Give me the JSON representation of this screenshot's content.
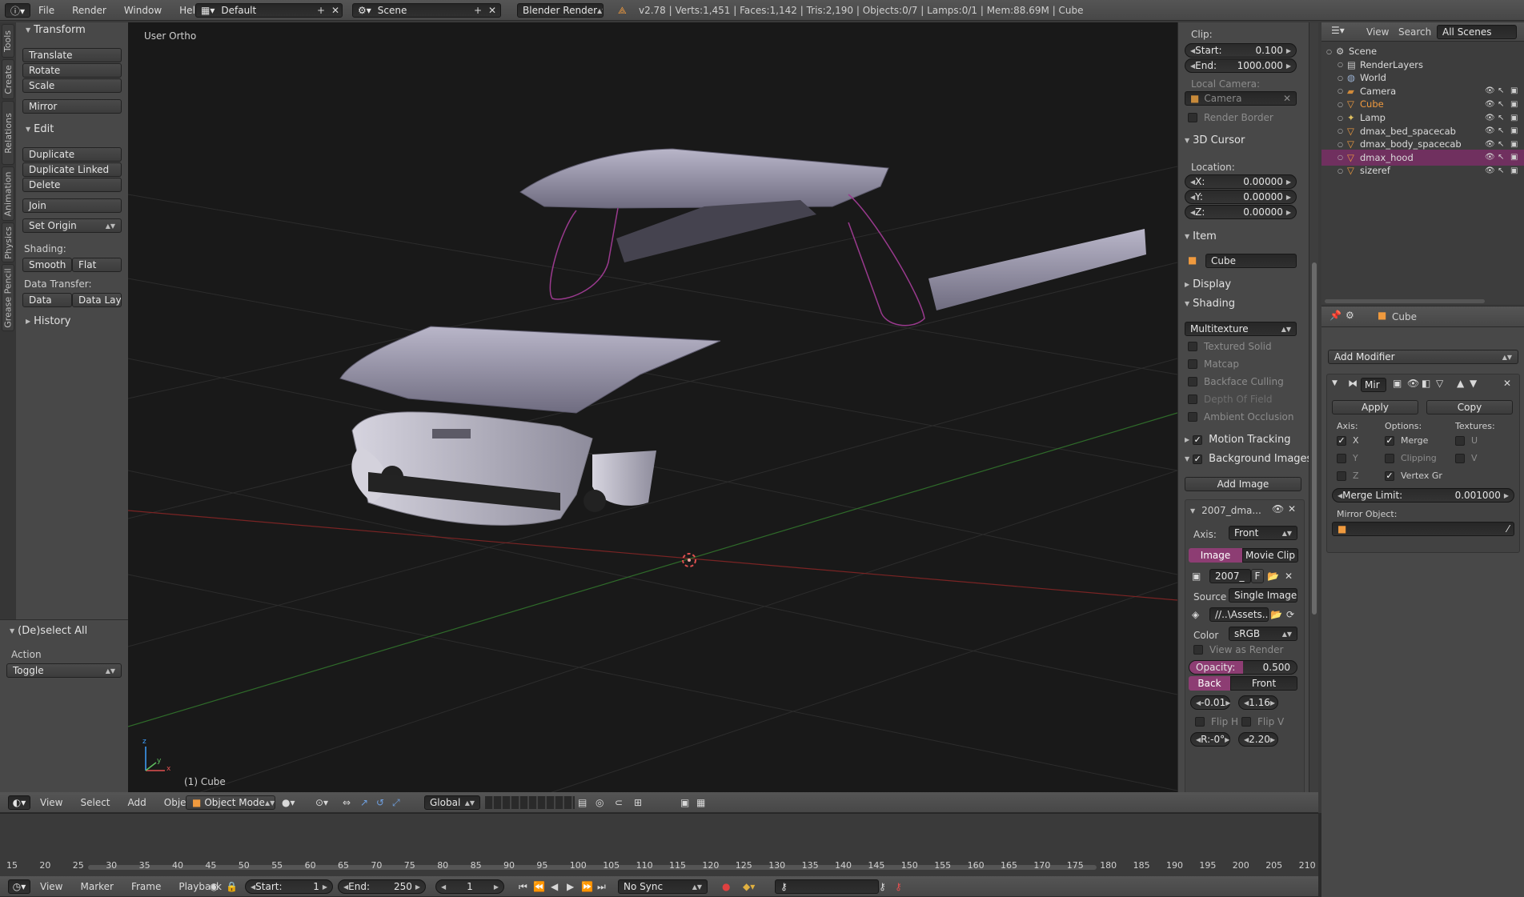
{
  "topbar": {
    "menus": [
      "File",
      "Render",
      "Window",
      "Help"
    ],
    "layout": "Default",
    "scene": "Scene",
    "engine": "Blender Render",
    "stats": "v2.78 | Verts:1,451 | Faces:1,142 | Tris:2,190 | Objects:0/7 | Lamps:0/1 | Mem:88.69M | Cube"
  },
  "tool_tabs": [
    "Tools",
    "Create",
    "Relations",
    "Animation",
    "Physics",
    "Grease Pencil"
  ],
  "toolshelf": {
    "transform_title": "Transform",
    "translate": "Translate",
    "rotate": "Rotate",
    "scale": "Scale",
    "mirror": "Mirror",
    "edit_title": "Edit",
    "duplicate": "Duplicate",
    "duplicate_linked": "Duplicate Linked",
    "delete": "Delete",
    "join": "Join",
    "set_origin": "Set Origin",
    "shading_label": "Shading:",
    "smooth": "Smooth",
    "flat": "Flat",
    "data_transfer_label": "Data Transfer:",
    "data": "Data",
    "data_layo": "Data Layo",
    "history_title": "History"
  },
  "operator": {
    "title": "(De)select All",
    "action_label": "Action",
    "action_value": "Toggle"
  },
  "viewport": {
    "view_label": "User Ortho",
    "object_label": "(1) Cube",
    "axis_x": "x",
    "axis_y": "y",
    "axis_z": "z"
  },
  "viewport_header": {
    "menus": [
      "View",
      "Select",
      "Add",
      "Object"
    ],
    "mode": "Object Mode",
    "orientation": "Global"
  },
  "properties": {
    "clip_label": "Clip:",
    "start_label": "Start:",
    "start_value": "0.100",
    "end_label": "End:",
    "end_value": "1000.000",
    "local_camera_label": "Local Camera:",
    "camera_value": "Camera",
    "render_border": "Render Border",
    "cursor_title": "3D Cursor",
    "location_label": "Location:",
    "x_label": "X:",
    "x_value": "0.00000",
    "y_label": "Y:",
    "y_value": "0.00000",
    "z_label": "Z:",
    "z_value": "0.00000",
    "item_title": "Item",
    "item_name": "Cube",
    "display_title": "Display",
    "shading_title": "Shading",
    "shading_mode": "Multitexture",
    "textured_solid": "Textured Solid",
    "matcap": "Matcap",
    "backface_culling": "Backface Culling",
    "depth_of_field": "Depth Of Field",
    "ambient_occlusion": "Ambient Occlusion",
    "motion_tracking": "Motion Tracking",
    "background_images": "Background Images",
    "add_image": "Add Image",
    "bg_name": "2007_dma...",
    "axis_label": "Axis:",
    "axis_value": "Front",
    "image_tab": "Image",
    "movie_clip_tab": "Movie Clip",
    "image_field": "2007_",
    "image_f": "F",
    "source_label": "Source",
    "source_value": "Single Image",
    "path_value": "//..\\Assets...",
    "color_label": "Color",
    "color_value": "sRGB",
    "view_as_render": "View as Render",
    "opacity_label": "Opacity:",
    "opacity_value": "0.500",
    "opacity_fraction": 0.5,
    "back_label": "Back",
    "front_label": "Front",
    "offset_x": "-0.01",
    "offset_y": "1.16",
    "flip_h": "Flip H",
    "flip_v": "Flip V",
    "rotation": "R:-0°",
    "size": "2.20"
  },
  "outliner": {
    "view": "View",
    "search": "Search",
    "scenes": "All Scenes",
    "items": [
      {
        "name": "Scene",
        "indent": 0,
        "icon": "scene-icon",
        "color": "#dcdcdc"
      },
      {
        "name": "RenderLayers",
        "indent": 1,
        "icon": "renderlayers-icon",
        "color": "#dcdcdc"
      },
      {
        "name": "World",
        "indent": 1,
        "icon": "world-icon",
        "color": "#dcdcdc"
      },
      {
        "name": "Camera",
        "indent": 1,
        "icon": "camera-icon",
        "color": "#dcdcdc"
      },
      {
        "name": "Cube",
        "indent": 1,
        "icon": "mesh-icon",
        "color": "#f09a3e"
      },
      {
        "name": "Lamp",
        "indent": 1,
        "icon": "lamp-icon",
        "color": "#dcdcdc"
      },
      {
        "name": "dmax_bed_spacecab",
        "indent": 1,
        "icon": "mesh-icon",
        "color": "#dcdcdc"
      },
      {
        "name": "dmax_body_spacecab",
        "indent": 1,
        "icon": "mesh-icon",
        "color": "#dcdcdc"
      },
      {
        "name": "dmax_hood",
        "indent": 1,
        "icon": "mesh-icon",
        "color": "#dcdcdc",
        "selected": true
      },
      {
        "name": "sizeref",
        "indent": 1,
        "icon": "mesh-icon",
        "color": "#dcdcdc"
      }
    ]
  },
  "modifier": {
    "object_name": "Cube",
    "add_modifier": "Add Modifier",
    "mod_name": "Mir",
    "apply": "Apply",
    "copy": "Copy",
    "axis_label": "Axis:",
    "options_label": "Options:",
    "textures_label": "Textures:",
    "x": "X",
    "y": "Y",
    "z": "Z",
    "merge": "Merge",
    "clipping": "Clipping",
    "vertex_groups": "Vertex Gr",
    "u": "U",
    "v": "V",
    "merge_limit_label": "Merge Limit:",
    "merge_limit_value": "0.001000",
    "mirror_object_label": "Mirror Object:"
  },
  "timeline": {
    "ticks": [
      15,
      20,
      25,
      30,
      35,
      40,
      45,
      50,
      55,
      60,
      65,
      70,
      75,
      80,
      85,
      90,
      95,
      100,
      105,
      110,
      115,
      120,
      125,
      130,
      135,
      140,
      145,
      150,
      155,
      160,
      165,
      170,
      175,
      180,
      185,
      190,
      195,
      200,
      205,
      210
    ],
    "menus": [
      "View",
      "Marker",
      "Frame",
      "Playback"
    ],
    "start_label": "Start:",
    "start_value": "1",
    "end_label": "End:",
    "end_value": "250",
    "current_frame": "1",
    "sync": "No Sync"
  }
}
